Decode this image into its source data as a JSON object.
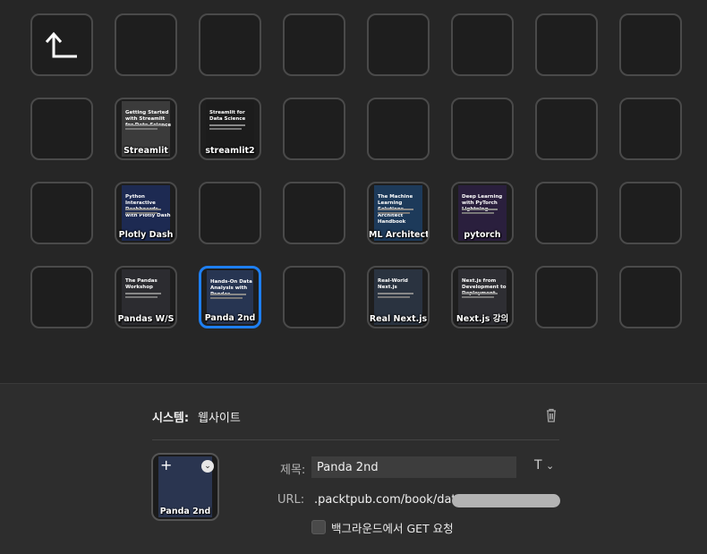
{
  "grid": {
    "keys": [
      {
        "slot": "r0c0",
        "type": "back",
        "label": ""
      },
      {
        "slot": "r1c1",
        "type": "book",
        "label": "Streamlit",
        "cover_title": "Getting Started with Streamlit for Data Science",
        "cover_color": "#3b3b3b"
      },
      {
        "slot": "r1c2",
        "type": "book",
        "label": "streamlit2",
        "cover_title": "Streamlit for Data Science",
        "cover_color": "#1c1c1c"
      },
      {
        "slot": "r2c1",
        "type": "book",
        "label": "Plotly Dash",
        "cover_title": "Python Interactive Dashboards with Plotly Dash",
        "cover_color": "#1d2a52"
      },
      {
        "slot": "r2c4",
        "type": "book",
        "label": "ML Architect",
        "cover_title": "The Machine Learning Solutions Architect Handbook",
        "cover_color": "#1d3a5a"
      },
      {
        "slot": "r2c5",
        "type": "book",
        "label": "pytorch",
        "cover_title": "Deep Learning with PyTorch Lightning",
        "cover_color": "#2a1f3d"
      },
      {
        "slot": "r3c1",
        "type": "book",
        "label": "Pandas W/S",
        "cover_title": "The Pandas Workshop",
        "cover_color": "#2c2c30"
      },
      {
        "slot": "r3c2",
        "type": "book",
        "label": "Panda 2nd",
        "cover_title": "Hands-On Data Analysis with Pandas",
        "cover_color": "#273552",
        "selected": true
      },
      {
        "slot": "r3c4",
        "type": "book",
        "label": "Real Next.js",
        "cover_title": "Real-World Next.js",
        "cover_color": "#2a3340"
      },
      {
        "slot": "r3c5",
        "type": "book",
        "label": "Next.js 강의",
        "cover_title": "Next.js from Development to Deployment",
        "cover_color": "#2e2e33"
      }
    ]
  },
  "panel": {
    "system_label": "시스템:",
    "system_value": "웹사이트",
    "preview_label": "Panda 2nd",
    "title_label": "제목:",
    "title_value": "Panda 2nd",
    "font_toggle": "T",
    "url_label": "URL:",
    "url_value": ".packtpub.com/book/data/",
    "background_get_label": "백그라운드에서 GET 요청"
  },
  "icons": {
    "back": "back-arrow-icon",
    "trash": "trash-icon",
    "preview_add": "plus-icon",
    "preview_menu": "chevron-down-icon",
    "font": "text-format-icon"
  },
  "colors": {
    "accent": "#1e7ff2",
    "background": "#262626",
    "panel": "#2d2d2d"
  }
}
